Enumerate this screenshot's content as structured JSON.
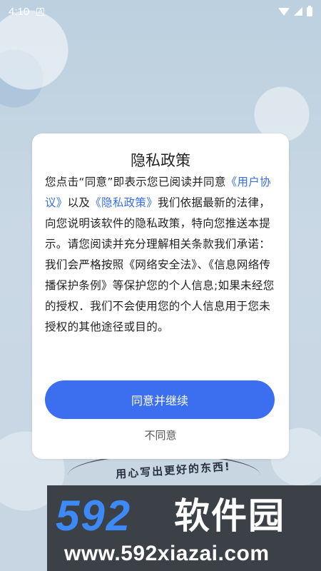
{
  "status_bar": {
    "time": "4:10",
    "notification_icon": "A"
  },
  "dialog": {
    "title": "隐私政策",
    "body": {
      "text_1": "您点击“同意”即表示您已阅读并同意",
      "link_user_agreement": "《用户协议》",
      "text_2": "以及",
      "link_privacy_policy": "《隐私政策》",
      "text_3": "我们依据最新的法律，向您说明该软件的隐私政策，特向您推送本提示。请您阅读并充分理解相关条款我们承诺：",
      "text_4": "我们会严格按照《网络安全法》、《信息网络传播保护条例》等保护您的个人信息;如果未经您的授权．我们不会使用您的个人信息用于您未授权的其他途径或目的。"
    },
    "agree_button": "同意并继续",
    "disagree_button": "不同意"
  },
  "background": {
    "slogan": "用心写出更好的东西!"
  },
  "watermark": {
    "logo_number": "592",
    "logo_text": "软件园",
    "url": "www.592xiazai.com"
  },
  "colors": {
    "accent": "#3c6ff0",
    "link": "#3a6ee8",
    "background": "#c9d8e4"
  }
}
